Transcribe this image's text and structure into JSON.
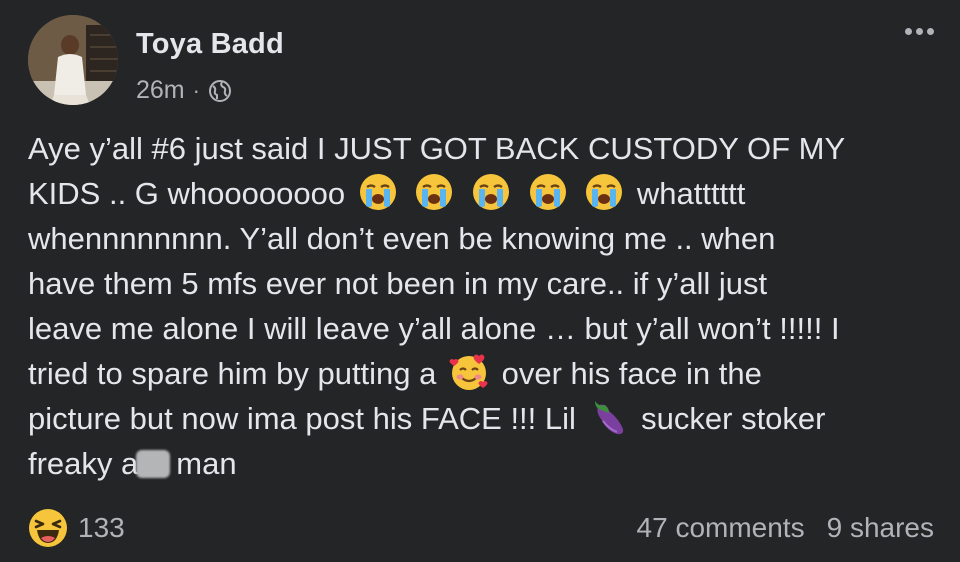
{
  "post": {
    "author": "Toya Badd",
    "time": "26m",
    "separator": "·",
    "privacy_icon": "globe-icon",
    "more_icon": "more-options-icon",
    "body_lines": {
      "l1": "Aye y’all #6 just said I JUST GOT BACK CUSTODY OF MY",
      "l2a": "KIDS .. G whoooooooo",
      "l2b": "whatttttt",
      "l3": "whennnnnnnn. Y’all don’t even be knowing me .. when",
      "l4": "have them 5 mfs ever not been in my care.. if y’all just",
      "l5": "leave me alone I will leave y’all alone … but y’all won’t !!!!! I",
      "l6a": "tried to spare him by putting a",
      "l6b": "over his face in the",
      "l7a": "picture but now ima post his FACE !!! Lil",
      "l7b": "sucker stoker",
      "l8a": "freaky a",
      "l8b": "man"
    },
    "emojis": [
      "loudly-crying-face",
      "smiling-face-with-hearts",
      "eggplant"
    ],
    "reaction_icon": "haha-icon",
    "reaction_count": "133",
    "comments": "47 comments",
    "shares": "9 shares"
  }
}
